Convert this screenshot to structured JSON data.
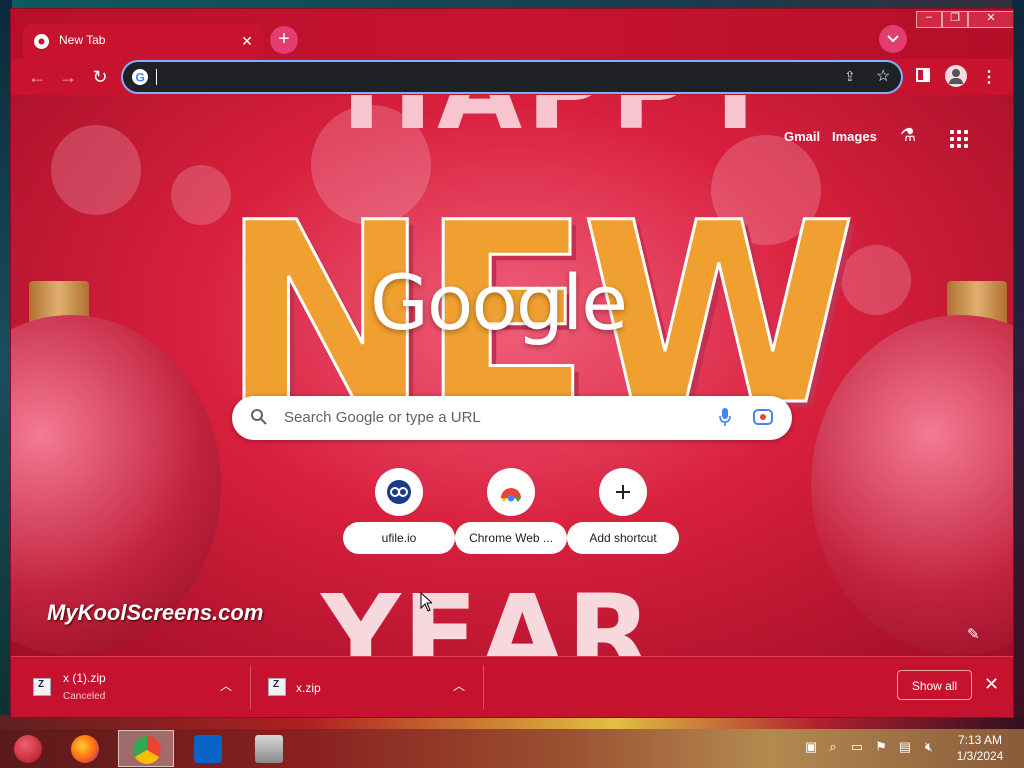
{
  "browser": {
    "tab": {
      "title": "New Tab"
    },
    "new_tab_symbol": "+",
    "window_controls": {
      "minimize": "–",
      "maximize": "❐",
      "close": "✕"
    }
  },
  "toolbar": {
    "back_icon": "←",
    "forward_icon": "→",
    "reload_icon": "↻",
    "omnibox_value": "",
    "bookmark_icon": "☆",
    "menu_icon": "⋮"
  },
  "ntp": {
    "links": {
      "gmail": "Gmail",
      "images": "Images"
    },
    "logo": "Google",
    "search_placeholder": "Search Google or type a URL",
    "shortcuts": [
      {
        "label": "ufile.io",
        "icon": "ufile-icon"
      },
      {
        "label": "Chrome Web ...",
        "icon": "chrome-web-store-icon"
      },
      {
        "label": "Add shortcut",
        "icon": "add-icon"
      }
    ],
    "watermark": "MyKoolScreens.com",
    "background_letters": {
      "top": "HAPPY",
      "middle": "NEW",
      "bottom": "YEAR"
    }
  },
  "downloads": {
    "items": [
      {
        "name": "x (1).zip",
        "status": "Canceled"
      },
      {
        "name": "x.zip",
        "status": ""
      }
    ],
    "show_all_label": "Show all",
    "close_icon": "✕"
  },
  "taskbar": {
    "apps": [
      "ornament-icon",
      "firefox-icon",
      "chrome-icon",
      "outlook-icon",
      "files-icon"
    ],
    "clock": {
      "time": "7:13 AM",
      "date": "1/3/2024"
    }
  },
  "colors": {
    "window": "#c4122f",
    "accent": "#e23d6e",
    "focus_ring": "#7ab4ff"
  }
}
